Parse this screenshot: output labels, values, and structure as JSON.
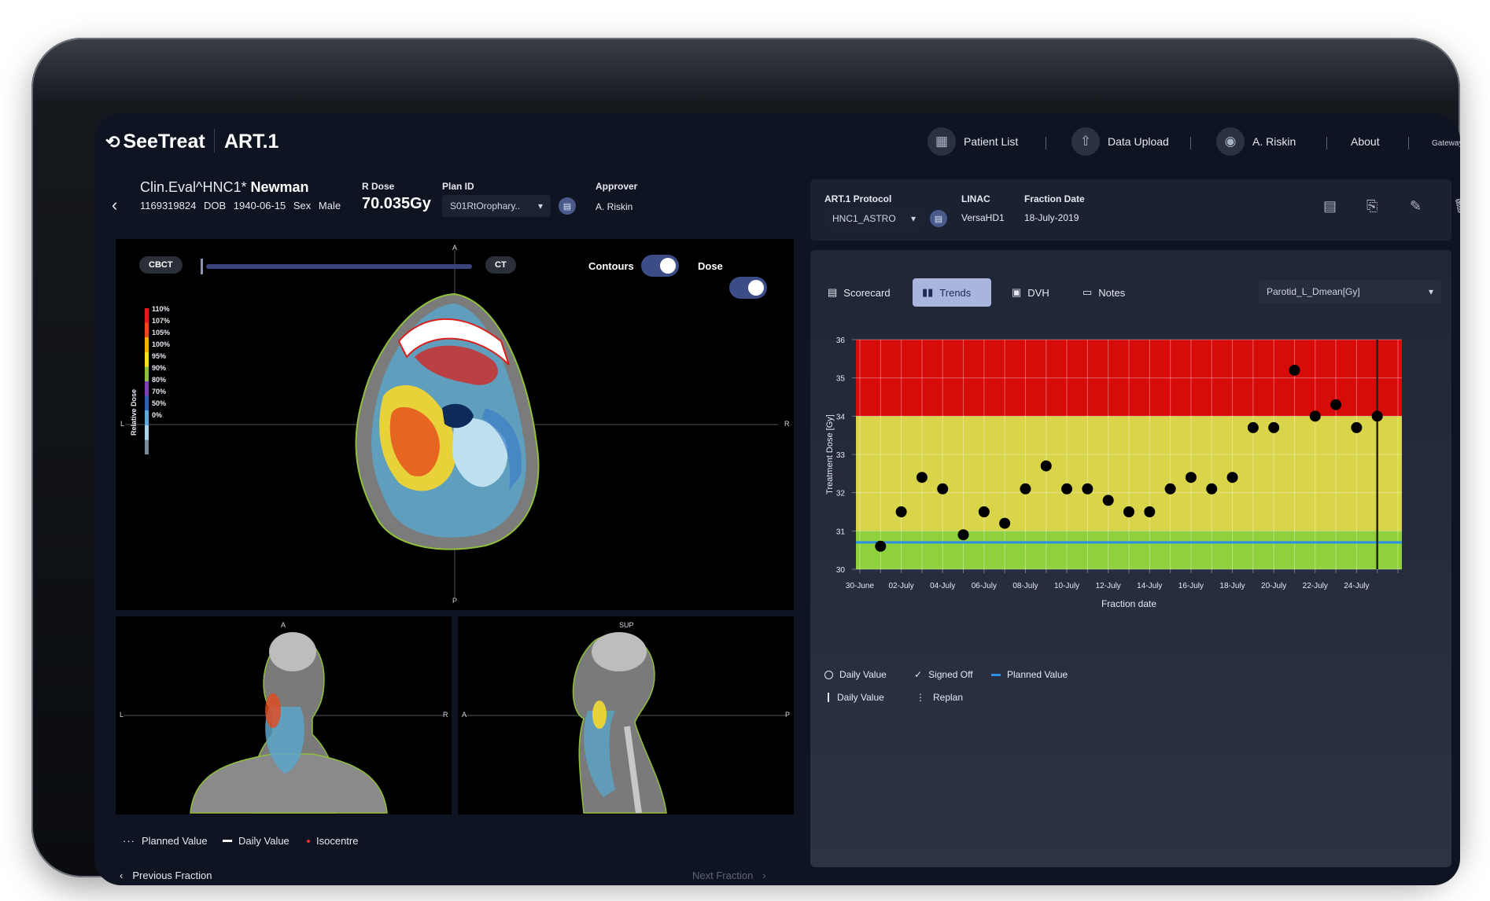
{
  "header": {
    "logo": "SeeTreat",
    "app_name": "ART.1",
    "nav": {
      "patient_list": "Patient List",
      "data_upload": "Data Upload",
      "user": "A. Riskin",
      "about": "About",
      "gateway": "Gateway"
    },
    "gateway_status_color": "#5fd63a"
  },
  "patient": {
    "name_prefix": "Clin.Eval^HNC1*",
    "name_last": "Newman",
    "id": "1169319824",
    "dob_label": "DOB",
    "dob": "1940-06-15",
    "sex_label": "Sex",
    "sex": "Male",
    "rdose_label": "R Dose",
    "rdose": "70.035Gy",
    "plan_id_label": "Plan ID",
    "plan_id": "S01RtOrophary..",
    "approver_label": "Approver",
    "approver": "A. Riskin"
  },
  "viewer": {
    "cbct_label": "CBCT",
    "ct_label": "CT",
    "contours_label": "Contours",
    "dose_label": "Dose",
    "contours_on": true,
    "dose_on": true,
    "orient": {
      "a": "A",
      "p": "P",
      "l": "L",
      "r": "R",
      "sup": "SUP"
    },
    "dose_legend_title": "Relative Dose",
    "dose_legend": [
      "110%",
      "107%",
      "105%",
      "100%",
      "95%",
      "90%",
      "80%",
      "70%",
      "50%",
      "0%"
    ],
    "dose_colors": [
      "#d9201c",
      "#e34a1c",
      "#f0b400",
      "#f5e21d",
      "#8fbf3a",
      "#7e3fb0",
      "#2f5fb0",
      "#5fa8d8",
      "#a8d2e6",
      "#7a8a96"
    ]
  },
  "bottom_legend": {
    "planned": "Planned Value",
    "daily": "Daily Value",
    "iso": "Isocentre"
  },
  "fraction_nav": {
    "prev": "Previous Fraction",
    "next": "Next Fraction"
  },
  "protocol": {
    "label": "ART.1 Protocol",
    "value": "HNC1_ASTRO",
    "linac_label": "LINAC",
    "linac": "VersaHD1",
    "fraction_date_label": "Fraction Date",
    "fraction_date": "18-July-2019"
  },
  "tabs": {
    "scorecard": "Scorecard",
    "trends": "Trends",
    "dvh": "DVH",
    "notes": "Notes"
  },
  "metric_select": "Parotid_L_Dmean[Gy]",
  "chart_data": {
    "type": "scatter",
    "ylabel": "Treatment Dose [Gy]",
    "xlabel": "Fraction date",
    "ylim": [
      30,
      36
    ],
    "yticks": [
      30,
      31,
      32,
      33,
      34,
      35,
      36
    ],
    "xticks": [
      "30-June",
      "02-July",
      "04-July",
      "06-July",
      "08-July",
      "10-July",
      "12-July",
      "14-July",
      "16-July",
      "18-July",
      "20-July",
      "22-July",
      "24-July"
    ],
    "bands": [
      {
        "from": 34,
        "to": 36,
        "color": "#d80b0b"
      },
      {
        "from": 31,
        "to": 34,
        "color": "#d9d54a"
      },
      {
        "from": 30,
        "to": 31,
        "color": "#8ed13d"
      }
    ],
    "planned_value": 30.7,
    "planned_color": "#2e8fe6",
    "current_fraction": "24-July",
    "points": [
      {
        "x": "01-July",
        "y": 30.6
      },
      {
        "x": "02-July",
        "y": 31.5
      },
      {
        "x": "03-July",
        "y": 32.4
      },
      {
        "x": "04-July",
        "y": 32.1
      },
      {
        "x": "05-July",
        "y": 30.9
      },
      {
        "x": "06-July",
        "y": 31.5
      },
      {
        "x": "07-July",
        "y": 31.2
      },
      {
        "x": "08-July",
        "y": 32.1
      },
      {
        "x": "09-July",
        "y": 32.7
      },
      {
        "x": "10-July",
        "y": 32.1
      },
      {
        "x": "11-July",
        "y": 32.1
      },
      {
        "x": "12-July",
        "y": 31.8
      },
      {
        "x": "13-July",
        "y": 31.5
      },
      {
        "x": "14-July",
        "y": 31.5
      },
      {
        "x": "15-July",
        "y": 32.1
      },
      {
        "x": "16-July",
        "y": 32.4
      },
      {
        "x": "17-July",
        "y": 32.1
      },
      {
        "x": "18-July",
        "y": 32.4
      },
      {
        "x": "19-July",
        "y": 33.7
      },
      {
        "x": "20-July",
        "y": 33.7
      },
      {
        "x": "21-July",
        "y": 35.2
      },
      {
        "x": "22-July",
        "y": 34.0
      },
      {
        "x": "23-July",
        "y": 34.3
      },
      {
        "x": "24-July",
        "y": 33.7
      },
      {
        "x": "25-July",
        "y": 34.0
      }
    ]
  },
  "chart_legend": {
    "daily_value": "Daily Value",
    "signed_off": "Signed Off",
    "planned_value": "Planned Value",
    "daily_value_2": "Daily Value",
    "replan": "Replan"
  }
}
